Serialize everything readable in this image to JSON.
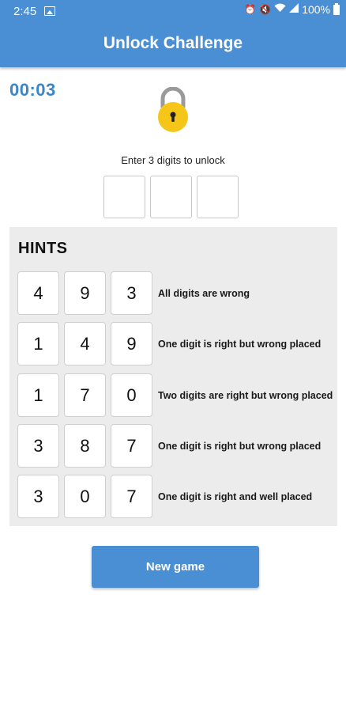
{
  "status_bar": {
    "time": "2:45",
    "battery": "100%",
    "icons": [
      "image-icon",
      "alarm-icon",
      "mute-icon",
      "wifi-icon",
      "signal-icon",
      "battery-icon"
    ]
  },
  "app": {
    "title": "Unlock Challenge"
  },
  "timer": "00:03",
  "lock_icon": "padlock-icon",
  "prompt": "Enter 3 digits to unlock",
  "code_inputs": [
    "",
    "",
    ""
  ],
  "hints": {
    "title": "HINTS",
    "rows": [
      {
        "digits": [
          "4",
          "9",
          "3"
        ],
        "text": "All digits are wrong"
      },
      {
        "digits": [
          "1",
          "4",
          "9"
        ],
        "text": "One digit is right but wrong placed"
      },
      {
        "digits": [
          "1",
          "7",
          "0"
        ],
        "text": "Two digits are right but wrong placed"
      },
      {
        "digits": [
          "3",
          "8",
          "7"
        ],
        "text": "One digit is right but wrong placed"
      },
      {
        "digits": [
          "3",
          "0",
          "7"
        ],
        "text": "One digit is right and well placed"
      }
    ]
  },
  "new_game_label": "New game",
  "colors": {
    "primary": "#4a8fd3",
    "timer": "#3a86c8",
    "lock": "#f5c518",
    "panel": "#ececec"
  }
}
